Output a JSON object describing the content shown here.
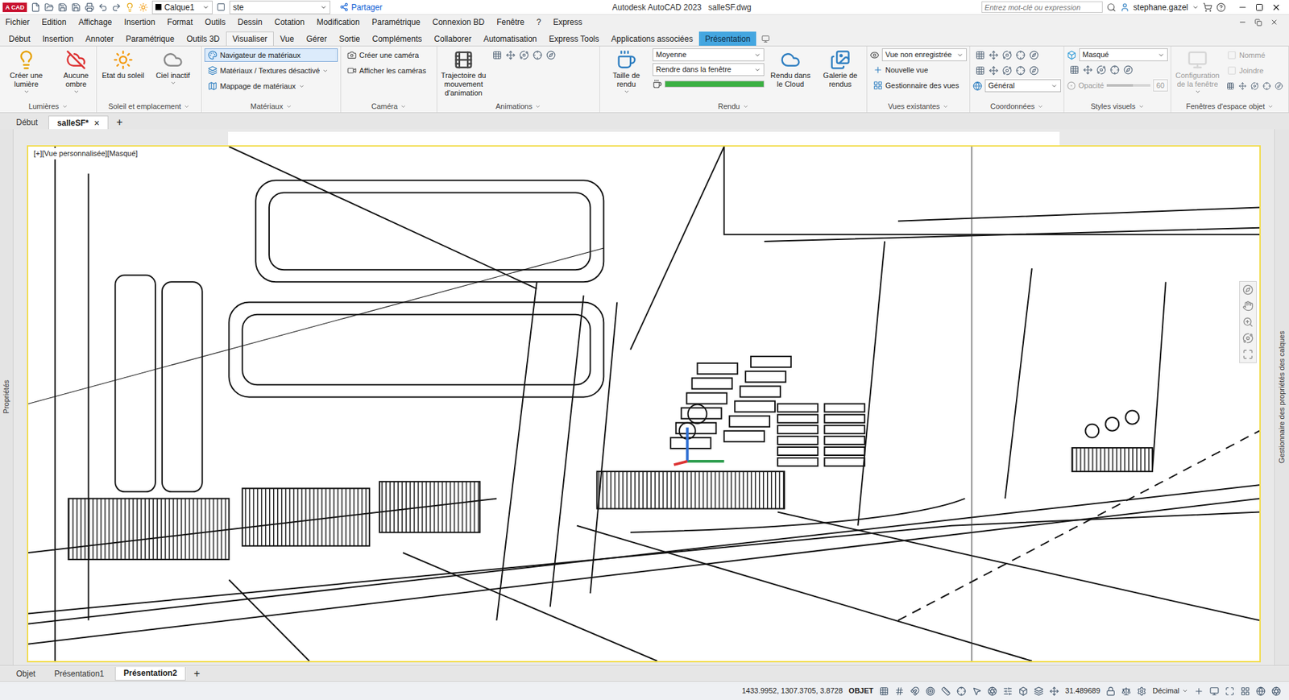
{
  "title_bar": {
    "app": "A CAD",
    "layer": "Calque1",
    "text_style": "ste",
    "share": "Partager",
    "title": "Autodesk AutoCAD 2023   salleSF.dwg",
    "search_placeholder": "Entrez mot-clé ou expression",
    "user": "stephane.gazel"
  },
  "menu": [
    "Fichier",
    "Edition",
    "Affichage",
    "Insertion",
    "Format",
    "Outils",
    "Dessin",
    "Cotation",
    "Modification",
    "Paramétrique",
    "Connexion BD",
    "Fenêtre",
    "?",
    "Express"
  ],
  "ribbon_tabs": [
    {
      "label": "Début",
      "selected": false,
      "highlighted": false
    },
    {
      "label": "Insertion",
      "selected": false,
      "highlighted": false
    },
    {
      "label": "Annoter",
      "selected": false,
      "highlighted": false
    },
    {
      "label": "Paramétrique",
      "selected": false,
      "highlighted": false
    },
    {
      "label": "Outils 3D",
      "selected": false,
      "highlighted": false
    },
    {
      "label": "Visualiser",
      "selected": true,
      "highlighted": false
    },
    {
      "label": "Vue",
      "selected": false,
      "highlighted": false
    },
    {
      "label": "Gérer",
      "selected": false,
      "highlighted": false
    },
    {
      "label": "Sortie",
      "selected": false,
      "highlighted": false
    },
    {
      "label": "Compléments",
      "selected": false,
      "highlighted": false
    },
    {
      "label": "Collaborer",
      "selected": false,
      "highlighted": false
    },
    {
      "label": "Automatisation",
      "selected": false,
      "highlighted": false
    },
    {
      "label": "Express Tools",
      "selected": false,
      "highlighted": false
    },
    {
      "label": "Applications associées",
      "selected": false,
      "highlighted": false
    },
    {
      "label": "Présentation",
      "selected": false,
      "highlighted": true
    }
  ],
  "ribbon_panels": [
    {
      "label": "Lumières",
      "columns": [
        [
          {
            "kind": "large",
            "label": "Créer une lumière",
            "selected": false,
            "disabled": false,
            "menu": true
          }
        ],
        [
          {
            "kind": "large",
            "label": "Aucune ombre",
            "selected": false,
            "disabled": false,
            "menu": true
          }
        ]
      ]
    },
    {
      "label": "Soleil et emplacement",
      "columns": [
        [
          {
            "kind": "large",
            "label": "Etat du soleil",
            "selected": false,
            "disabled": false,
            "menu": false
          }
        ],
        [
          {
            "kind": "large",
            "label": "Ciel inactif",
            "selected": false,
            "disabled": false,
            "menu": true
          }
        ]
      ]
    },
    {
      "label": "Matériaux",
      "columns": [
        [
          {
            "kind": "small",
            "label": "Navigateur de matériaux",
            "selected": true,
            "disabled": false,
            "menu": false
          },
          {
            "kind": "small",
            "label": "Matériaux / Textures désactivé",
            "selected": false,
            "disabled": false,
            "menu": true
          },
          {
            "kind": "small",
            "label": "Mappage de matériaux",
            "selected": false,
            "disabled": false,
            "menu": true
          }
        ]
      ]
    },
    {
      "label": "Caméra",
      "columns": [
        [
          {
            "kind": "small",
            "label": "Créer une caméra",
            "selected": false,
            "disabled": false,
            "menu": false
          },
          {
            "kind": "small",
            "label": "Afficher les caméras",
            "selected": false,
            "disabled": false,
            "menu": false
          }
        ]
      ]
    },
    {
      "label": "Animations",
      "columns": [
        [
          {
            "kind": "large",
            "label": "Trajectoire du mouvement d'animation",
            "selected": false,
            "disabled": false,
            "menu": false
          }
        ],
        [
          {
            "kind": "icons"
          }
        ]
      ]
    },
    {
      "label": "Rendu",
      "columns": [
        [
          {
            "kind": "large",
            "label": "Taille de rendu",
            "selected": false,
            "disabled": false,
            "menu": true
          }
        ],
        [
          {
            "kind": "dropdown",
            "value": "Moyenne"
          },
          {
            "kind": "dropdown",
            "value": "Rendre dans la fenêtre"
          },
          {
            "kind": "progress",
            "level": 1
          }
        ],
        [
          {
            "kind": "large",
            "label": "Rendu dans le Cloud",
            "selected": false,
            "disabled": false,
            "menu": false
          }
        ],
        [
          {
            "kind": "large",
            "label": "Galerie de rendus",
            "selected": false,
            "disabled": false,
            "menu": false
          }
        ]
      ]
    },
    {
      "label": "Vues existantes",
      "columns": [
        [
          {
            "kind": "dropdown",
            "value": "Vue non enregistrée"
          },
          {
            "kind": "small",
            "label": "Nouvelle vue",
            "selected": false,
            "disabled": false,
            "menu": false
          },
          {
            "kind": "small",
            "label": "Gestionnaire des vues",
            "selected": false,
            "disabled": false,
            "menu": false
          }
        ]
      ]
    },
    {
      "label": "Coordonnées",
      "columns": [
        [
          {
            "kind": "icons"
          },
          {
            "kind": "icons"
          },
          {
            "kind": "dropdown",
            "value": "Général"
          }
        ]
      ]
    },
    {
      "label": "Styles visuels",
      "columns": [
        [
          {
            "kind": "dropdown",
            "value": "Masqué"
          },
          {
            "kind": "icons"
          },
          {
            "kind": "slider",
            "label": "Opacité",
            "value": "60",
            "level": 0.6,
            "disabled": true
          }
        ]
      ]
    },
    {
      "label": "Fenêtres d'espace objet",
      "columns": [
        [
          {
            "kind": "large",
            "label": "Configuration de la fenêtre",
            "selected": false,
            "disabled": true,
            "menu": true
          }
        ],
        [
          {
            "kind": "small",
            "label": "Nommé",
            "selected": false,
            "disabled": true,
            "menu": false
          },
          {
            "kind": "small",
            "label": "Joindre",
            "selected": false,
            "disabled": true,
            "menu": false
          },
          {
            "kind": "icons"
          }
        ]
      ]
    }
  ],
  "file_tabs": [
    {
      "label": "Début",
      "selected": false,
      "closable": false
    },
    {
      "label": "salleSF*",
      "selected": true,
      "closable": true
    }
  ],
  "close_glyph": "×",
  "new_tab": "+",
  "side_panels": {
    "left": "Propriétés",
    "right": "Gestionnaire des propriétés des calques"
  },
  "viewport": {
    "label": "[+][Vue personnalisée][Masqué]"
  },
  "layout_tabs": [
    {
      "label": "Objet",
      "selected": false
    },
    {
      "label": "Présentation1",
      "selected": false
    },
    {
      "label": "Présentation2",
      "selected": true
    }
  ],
  "new_layout": "+",
  "status_bar": {
    "coordinates": "1433.9952, 1307.3705, 3.8728",
    "mode": "OBJET",
    "scale": "31.489689",
    "units": "Décimal"
  }
}
